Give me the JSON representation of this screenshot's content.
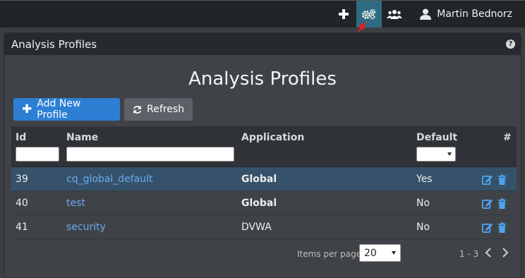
{
  "topbar": {
    "user_name": "Martin Bednorz",
    "icons": [
      "plus-icon",
      "gears-icon",
      "users-icon",
      "user-icon"
    ],
    "active_color": "#2f6b82"
  },
  "panel": {
    "title": "Analysis Profiles",
    "help_symbol": "?"
  },
  "page_title": "Analysis Profiles",
  "toolbar": {
    "add_label": "Add New Profile",
    "refresh_label": "Refresh",
    "primary_color": "#2d7fd3"
  },
  "table": {
    "columns": {
      "id": "Id",
      "name": "Name",
      "application": "Application",
      "default": "Default",
      "actions": "#"
    },
    "rows": [
      {
        "id": "39",
        "name": "cq_global_default",
        "application": "Global",
        "app_bold": true,
        "default": "Yes",
        "selected": true
      },
      {
        "id": "40",
        "name": "test",
        "application": "Global",
        "app_bold": true,
        "default": "No",
        "selected": false
      },
      {
        "id": "41",
        "name": "security",
        "application": "DVWA",
        "app_bold": false,
        "default": "No",
        "selected": false
      }
    ]
  },
  "footer": {
    "items_per_page_label": "Items per page",
    "items_per_page_value": "20",
    "range": "1 - 3"
  },
  "annotation_color": "#e02020"
}
